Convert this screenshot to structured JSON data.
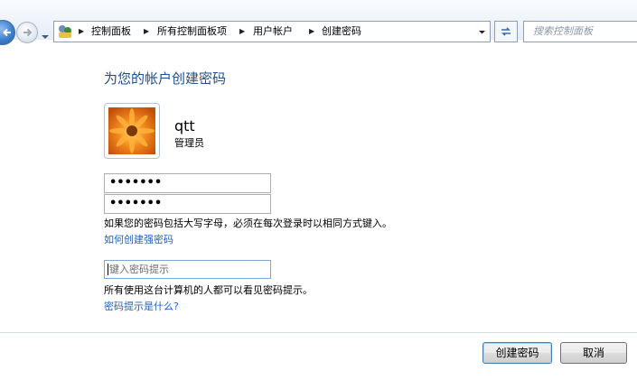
{
  "nav": {
    "breadcrumb": [
      "控制面板",
      "所有控制面板项",
      "用户帐户",
      "创建密码"
    ],
    "search_placeholder": "搜索控制面板"
  },
  "main": {
    "title": "为您的帐户创建密码",
    "user": {
      "name": "qtt",
      "role": "管理员"
    },
    "new_password_value": "•••••••",
    "confirm_password_value": "•••••••",
    "case_note": "如果您的密码包括大写字母，必须在每次登录时以相同方式键入。",
    "strong_password_link": "如何创建强密码",
    "hint_placeholder": "键入密码提示",
    "hint_note": "所有使用这台计算机的人都可以看见密码提示。",
    "hint_help_link": "密码提示是什么?"
  },
  "buttons": {
    "create_label": "创建密码",
    "cancel_label": "取消"
  },
  "colors": {
    "title": "#1f4e8c",
    "link": "#1f63b8",
    "nav_gradient_top": "#fafcfe",
    "nav_gradient_bottom": "#e4ecf6"
  },
  "icons": [
    "back-arrow-icon",
    "forward-arrow-icon",
    "history-dropdown-icon",
    "control-panel-icon",
    "refresh-icon",
    "chevron-down-icon"
  ]
}
